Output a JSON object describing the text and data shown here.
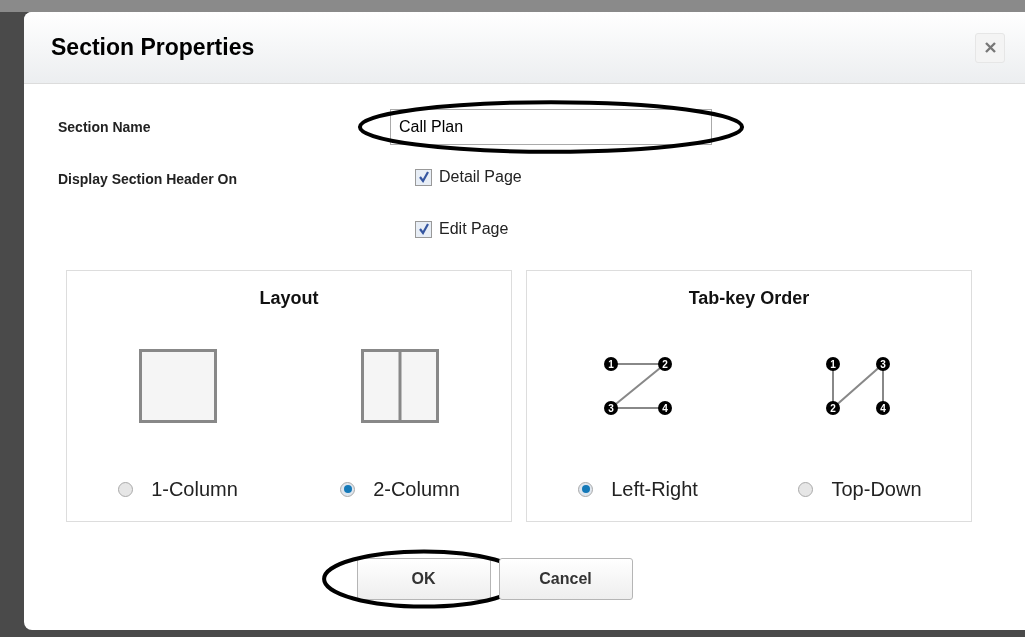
{
  "dialog": {
    "title": "Section Properties",
    "section_name": {
      "label": "Section Name",
      "value": "Call Plan"
    },
    "display_header": {
      "label": "Display Section Header On",
      "options": [
        {
          "label": "Detail Page",
          "checked": true
        },
        {
          "label": "Edit Page",
          "checked": true
        }
      ]
    },
    "panels": [
      {
        "title": "Layout",
        "options": [
          {
            "kind": "one-column",
            "label": "1-Column",
            "selected": false
          },
          {
            "kind": "two-column",
            "label": "2-Column",
            "selected": true
          }
        ]
      },
      {
        "title": "Tab-key Order",
        "options": [
          {
            "kind": "left-right",
            "label": "Left-Right",
            "selected": true,
            "nodes": [
              "1",
              "2",
              "3",
              "4"
            ]
          },
          {
            "kind": "top-down",
            "label": "Top-Down",
            "selected": false,
            "nodes": [
              "1",
              "2",
              "3",
              "4"
            ]
          }
        ]
      }
    ],
    "buttons": [
      {
        "label": "OK"
      },
      {
        "label": "Cancel"
      }
    ]
  }
}
